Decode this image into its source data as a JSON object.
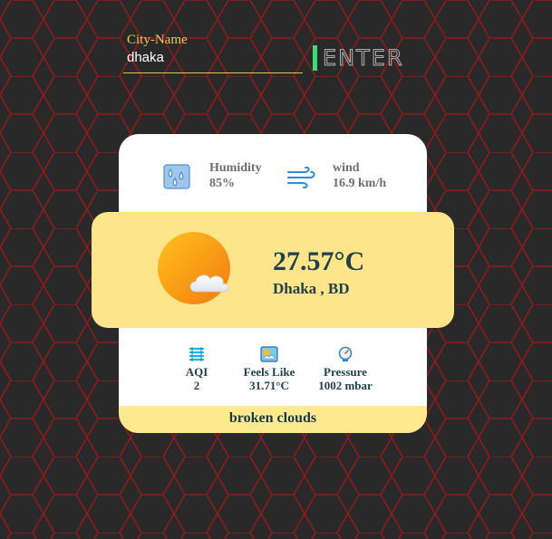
{
  "search": {
    "label": "City-Name",
    "value": "dhaka",
    "button_label": "ENTER"
  },
  "stats_top": {
    "humidity_label": "Humidity",
    "humidity_value": "85%",
    "wind_label": "wind",
    "wind_value": "16.9 km/h"
  },
  "main": {
    "temperature": "27.57°C",
    "location": "Dhaka , BD",
    "icon": "partly-cloudy-sun-icon"
  },
  "stats_bottom": {
    "aqi_label": "AQI",
    "aqi_value": "2",
    "feels_like_label": "Feels Like",
    "feels_like_value": "31.71°C",
    "pressure_label": "Pressure",
    "pressure_value": "1002 mbar"
  },
  "description": "broken clouds",
  "colors": {
    "background": "#292929",
    "hex_grid": "#8e1b1b",
    "accent_label": "#f3c75a",
    "enter_bar": "#3ed97a",
    "panel_yellow": "#ffe58a",
    "text_dark": "#20404c"
  }
}
